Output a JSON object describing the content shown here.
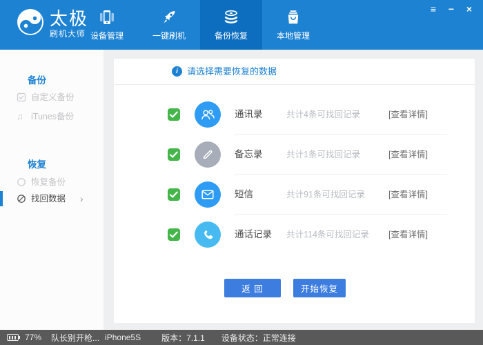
{
  "window": {
    "controls": {
      "menu": "≡",
      "minimize": "−",
      "close": "×"
    }
  },
  "header": {
    "logo_title": "太极",
    "logo_subtitle": "刷机大师",
    "tabs": [
      {
        "label": "设备管理",
        "icon": "device-icon",
        "active": false
      },
      {
        "label": "一键刷机",
        "icon": "rocket-icon",
        "active": false
      },
      {
        "label": "备份恢复",
        "icon": "database-icon",
        "active": true
      },
      {
        "label": "本地管理",
        "icon": "bag-icon",
        "active": false
      }
    ]
  },
  "sidebar": {
    "sections": [
      {
        "title": "备份",
        "items": [
          {
            "label": "自定义备份",
            "icon": "checkbox-icon",
            "selected": false
          },
          {
            "label": "iTunes备份",
            "icon": "music-note-icon",
            "selected": false
          }
        ]
      },
      {
        "title": "恢复",
        "items": [
          {
            "label": "恢复备份",
            "icon": "circle-icon",
            "selected": false
          },
          {
            "label": "找回数据",
            "icon": "slash-circle-icon",
            "selected": true,
            "arrow": "›"
          }
        ]
      }
    ]
  },
  "main": {
    "prompt_icon_glyph": "i",
    "prompt": "请选择需要恢复的数据",
    "rows": [
      {
        "label": "通讯录",
        "count_text": "共计4条可找回记录",
        "detail_link": "[查看详情]",
        "checked": true,
        "icon": "contacts-icon"
      },
      {
        "label": "备忘录",
        "count_text": "共计1条可找回记录",
        "detail_link": "[查看详情]",
        "checked": true,
        "icon": "memo-icon"
      },
      {
        "label": "短信",
        "count_text": "共计91条可找回记录",
        "detail_link": "[查看详情]",
        "checked": true,
        "icon": "sms-icon"
      },
      {
        "label": "通话记录",
        "count_text": "共计114条可找回记录",
        "detail_link": "[查看详情]",
        "checked": true,
        "icon": "call-icon"
      }
    ],
    "buttons": {
      "back": "返 回",
      "start": "开始恢复"
    }
  },
  "statusbar": {
    "battery_percent": "77%",
    "device_name": "队长别开枪...",
    "device_model": "iPhone5S",
    "version": "版本：7.1.1",
    "device_status": "设备状态：正常连接"
  },
  "colors": {
    "header_blue": "#1d82d2",
    "active_tab_blue": "#0d6ebf",
    "accent_blue": "#1e82d3",
    "button_blue": "#3d7de0",
    "check_green": "#44b549",
    "row_icon_blue": "#2e9cf4",
    "row_icon_lightblue": "#47bbf1",
    "row_icon_gray": "#a7aeb9",
    "statusbar_gray": "#595959"
  }
}
